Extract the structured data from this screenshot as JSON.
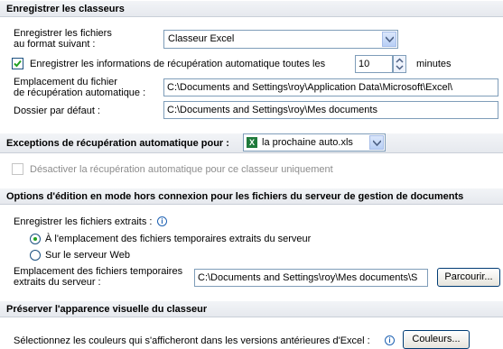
{
  "sections": {
    "save": "Enregistrer les classeurs",
    "exceptions": "Exceptions de récupération automatique pour :",
    "offline": "Options d'édition en mode hors connexion pour les fichiers du serveur de gestion de documents",
    "preserve": "Préserver l'apparence visuelle du classeur"
  },
  "save": {
    "format_label_line1": "Enregistrer les fichiers",
    "format_label_line2": "au format suivant :",
    "format_value": "Classeur Excel",
    "autorecover_label": "Enregistrer les informations de récupération automatique toutes les",
    "autorecover_checked": true,
    "autorecover_minutes": "10",
    "minutes_label": "minutes",
    "location_label_line1": "Emplacement du fichier",
    "location_label_line2": "de récupération automatique :",
    "location_value": "C:\\Documents and Settings\\roy\\Application Data\\Microsoft\\Excel\\",
    "default_folder_label": "Dossier par défaut :",
    "default_folder_value": "C:\\Documents and Settings\\roy\\Mes documents"
  },
  "exceptions": {
    "workbook_value": "la prochaine auto.xls",
    "file_icon_glyph": "X",
    "disable_label": "Désactiver la récupération automatique pour ce classeur uniquement",
    "disable_checked": false
  },
  "offline": {
    "save_checked_out_label": "Enregistrer les fichiers extraits :",
    "info_glyph": "i",
    "option1_label": "À l'emplacement des fichiers temporaires extraits du serveur",
    "option2_label": "Sur le serveur Web",
    "option_selected": 1,
    "temp_location_label_line1": "Emplacement des fichiers temporaires",
    "temp_location_label_line2": "extraits du serveur :",
    "temp_location_value": "C:\\Documents and Settings\\roy\\Mes documents\\S",
    "browse_label": "Parcourir..."
  },
  "preserve": {
    "colors_label": "Sélectionnez les couleurs qui s'afficheront dans les versions antérieures d'Excel :",
    "info_glyph": "i",
    "colors_button": "Couleurs..."
  }
}
